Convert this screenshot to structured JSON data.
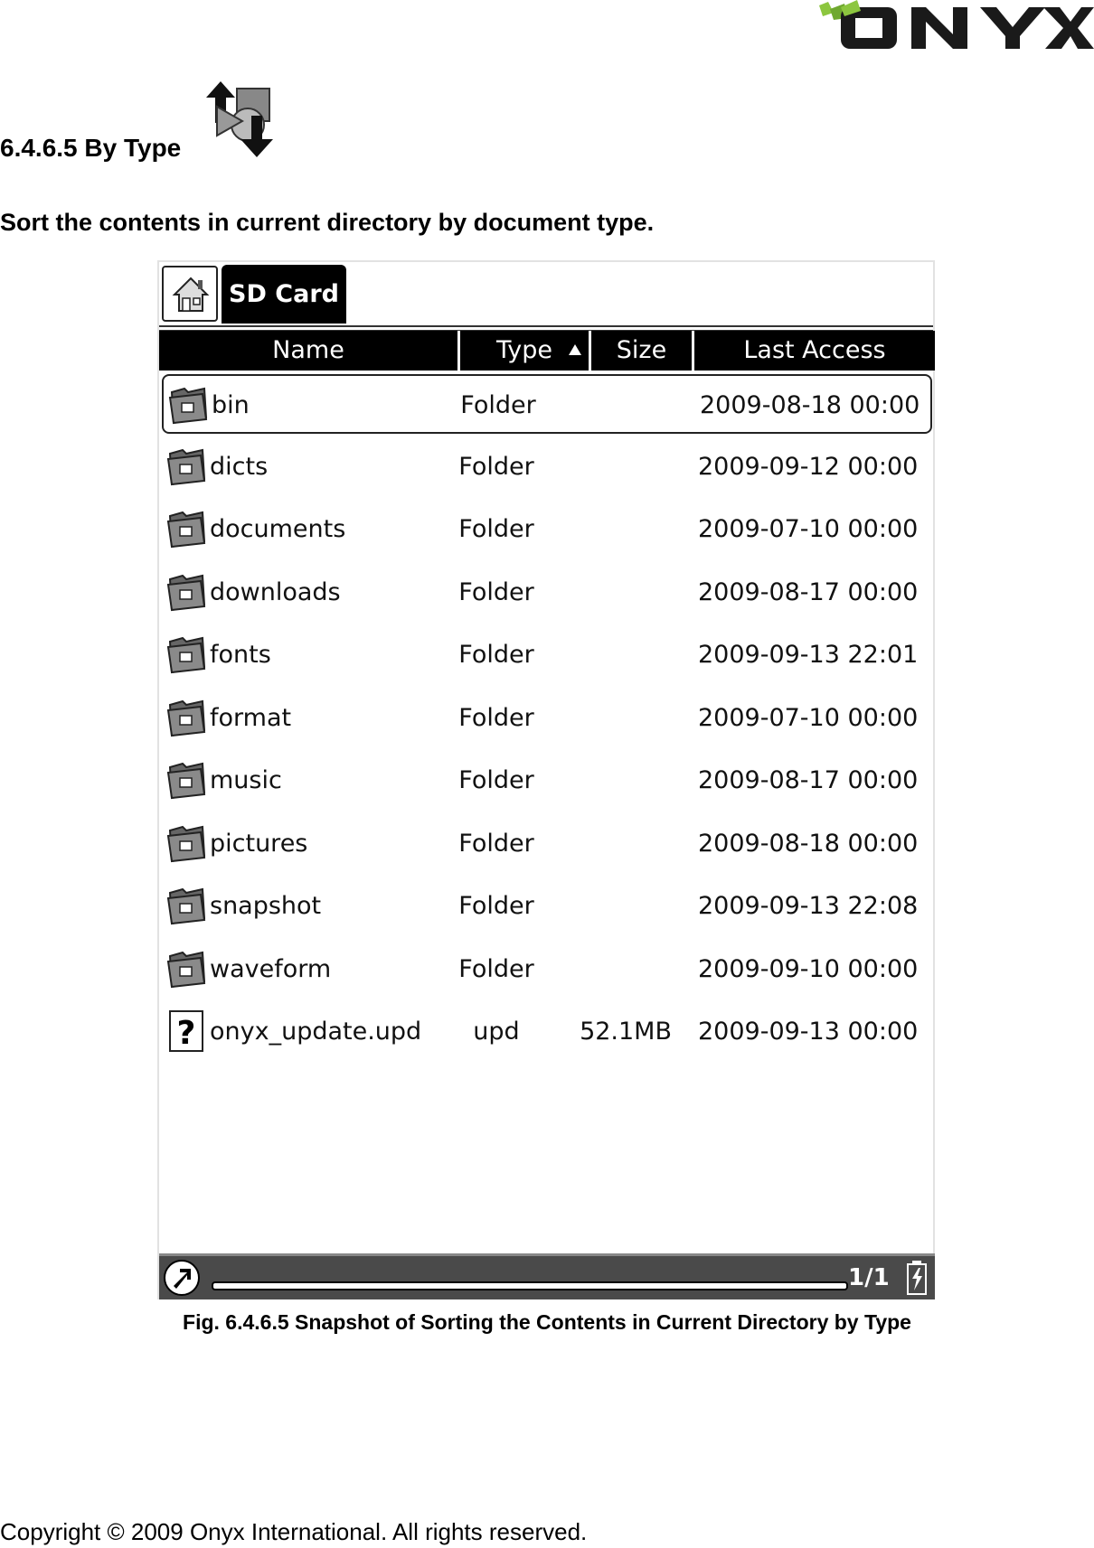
{
  "logo": {
    "text": "ONYX",
    "accent_color": "#8cc63f"
  },
  "section": {
    "title": "6.4.6.5 By Type",
    "icon": "sort-by-type-icon"
  },
  "description": "Sort the contents in current directory by document type.",
  "device": {
    "tab_label": "SD Card",
    "columns": {
      "name": "Name",
      "type": "Type",
      "size": "Size",
      "last_access": "Last Access"
    },
    "sort": {
      "column": "Type",
      "direction": "ascending"
    },
    "files": [
      {
        "name": "bin",
        "type": "Folder",
        "size": "",
        "last_access": "2009-08-18 00:00",
        "icon": "folder-icon",
        "selected": true
      },
      {
        "name": "dicts",
        "type": "Folder",
        "size": "",
        "last_access": "2009-09-12 00:00",
        "icon": "folder-icon"
      },
      {
        "name": "documents",
        "type": "Folder",
        "size": "",
        "last_access": "2009-07-10 00:00",
        "icon": "folder-icon"
      },
      {
        "name": "downloads",
        "type": "Folder",
        "size": "",
        "last_access": "2009-08-17 00:00",
        "icon": "folder-icon"
      },
      {
        "name": "fonts",
        "type": "Folder",
        "size": "",
        "last_access": "2009-09-13 22:01",
        "icon": "folder-icon"
      },
      {
        "name": "format",
        "type": "Folder",
        "size": "",
        "last_access": "2009-07-10 00:00",
        "icon": "folder-icon"
      },
      {
        "name": "music",
        "type": "Folder",
        "size": "",
        "last_access": "2009-08-17 00:00",
        "icon": "folder-icon"
      },
      {
        "name": "pictures",
        "type": "Folder",
        "size": "",
        "last_access": "2009-08-18 00:00",
        "icon": "folder-icon"
      },
      {
        "name": "snapshot",
        "type": "Folder",
        "size": "",
        "last_access": "2009-09-13 22:08",
        "icon": "folder-icon"
      },
      {
        "name": "waveform",
        "type": "Folder",
        "size": "",
        "last_access": "2009-09-10 00:00",
        "icon": "folder-icon"
      },
      {
        "name": "onyx_update.upd",
        "type": "upd",
        "size": "52.1MB",
        "last_access": "2009-09-13 00:00",
        "icon": "unknown-file-icon"
      }
    ],
    "status": {
      "page": "1/1",
      "progress": 1.0
    }
  },
  "caption": "Fig. 6.4.6.5 Snapshot of Sorting the Contents in Current Directory by Type",
  "copyright": "Copyright © 2009 Onyx International. All rights reserved."
}
